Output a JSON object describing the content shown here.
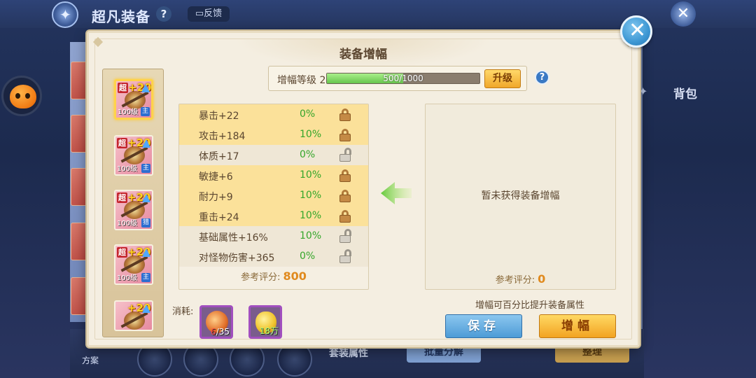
{
  "background": {
    "title": "超凡装备",
    "help": "?",
    "feedback": "反馈",
    "bag": "背包",
    "batch_split": "批量分解",
    "tidy": "整理",
    "set_attr": "套装属性",
    "scheme": "方案"
  },
  "dialog": {
    "title": "装备增幅",
    "level_label": "增幅等级 2",
    "progress": {
      "current": 500,
      "max": 1000,
      "text": "500/1000"
    },
    "upgrade_button": "升级",
    "help_button": "?",
    "attributes": [
      {
        "name": "暴击+22",
        "pct": "0%",
        "locked": true,
        "highlight": true
      },
      {
        "name": "攻击+184",
        "pct": "10%",
        "locked": true,
        "highlight": true
      },
      {
        "name": "体质+17",
        "pct": "0%",
        "locked": false,
        "highlight": false
      },
      {
        "name": "敏捷+6",
        "pct": "10%",
        "locked": true,
        "highlight": true
      },
      {
        "name": "耐力+9",
        "pct": "10%",
        "locked": true,
        "highlight": true
      },
      {
        "name": "重击+24",
        "pct": "10%",
        "locked": true,
        "highlight": true
      },
      {
        "name": "基础属性+16%",
        "pct": "10%",
        "locked": false,
        "highlight": false
      },
      {
        "name": "对怪物伤害+365",
        "pct": "0%",
        "locked": false,
        "highlight": false
      }
    ],
    "score_label": "参考评分:",
    "score_value": "800",
    "result_empty": "暂未获得装备增幅",
    "result_score_label": "参考评分:",
    "result_score_value": "0",
    "cost_label": "消耗:",
    "cost_items": [
      {
        "have": "6",
        "need": "/35"
      },
      {
        "amount": "18万"
      }
    ],
    "hint": "增幅可百分比提升装备属性",
    "save_button": "保存",
    "amplify_button": "增幅"
  },
  "items": [
    {
      "super": "超",
      "plus": "+20",
      "level": "100级",
      "tag": "主",
      "selected": true
    },
    {
      "super": "超",
      "plus": "+20",
      "level": "100级",
      "tag": "主",
      "selected": false
    },
    {
      "super": "超",
      "plus": "+20",
      "level": "100级",
      "tag": "猎",
      "selected": false
    },
    {
      "super": "超",
      "plus": "+20",
      "level": "100级",
      "tag": "主",
      "selected": false
    },
    {
      "super": "",
      "plus": "+20",
      "level": "",
      "tag": "",
      "selected": false
    }
  ],
  "colors": {
    "accent_gold": "#fbe19a",
    "pct_green": "#34a62a",
    "score_orange": "#e08a1e",
    "save_blue": "#4d9bd6",
    "amplify_orange": "#f2a322"
  },
  "icons": [
    "close-icon",
    "lock-icon",
    "unlock-icon",
    "arrow-left-icon",
    "help-icon",
    "feedback-icon"
  ]
}
